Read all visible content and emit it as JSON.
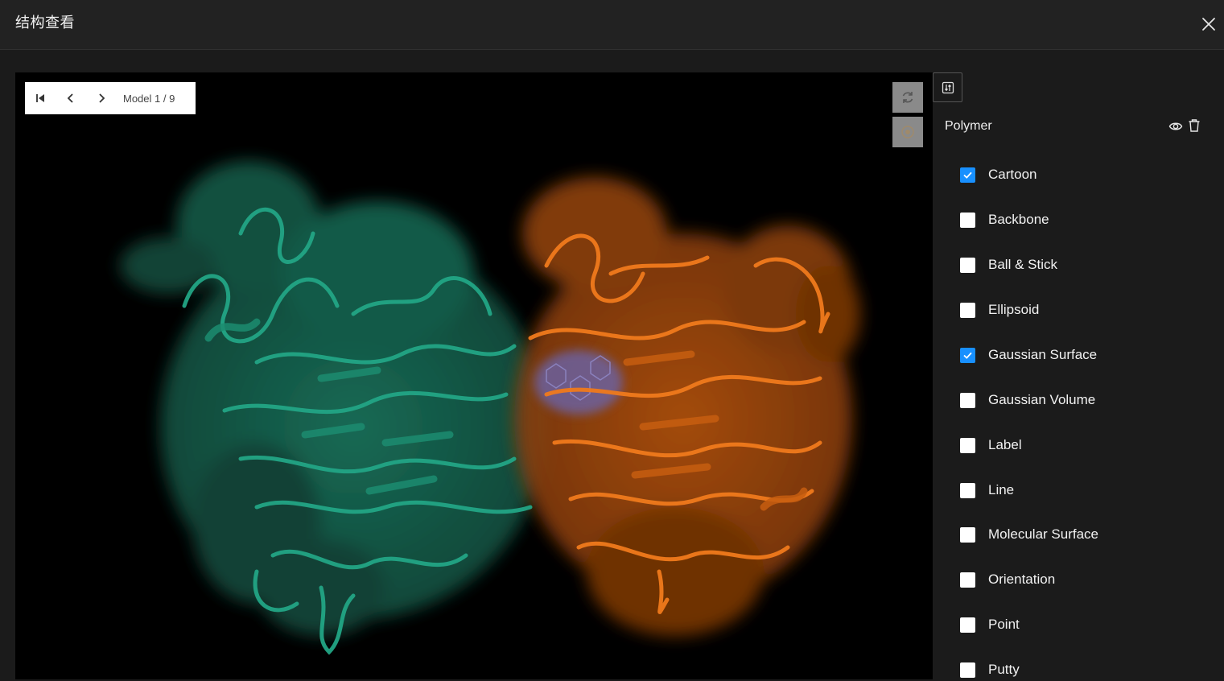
{
  "window": {
    "title": "结构查看"
  },
  "icons": {
    "close": "close-icon",
    "first": "skip-to-first-icon",
    "prev": "chevron-left-icon",
    "next": "chevron-right-icon",
    "reset": "refresh-icon",
    "tool2": "target-icon",
    "settings": "sliders-icon",
    "visibility": "eye-icon",
    "delete": "trash-icon"
  },
  "viewer": {
    "model_label": "Model 1 / 9",
    "colors": {
      "chain_a": "#1a8f74",
      "chain_b": "#d96510",
      "ligand": "#7a6fb0",
      "background": "#000000"
    }
  },
  "panel": {
    "group_title": "Polymer",
    "representations": [
      {
        "label": "Cartoon",
        "checked": true
      },
      {
        "label": "Backbone",
        "checked": false
      },
      {
        "label": "Ball & Stick",
        "checked": false
      },
      {
        "label": "Ellipsoid",
        "checked": false
      },
      {
        "label": "Gaussian Surface",
        "checked": true
      },
      {
        "label": "Gaussian Volume",
        "checked": false
      },
      {
        "label": "Label",
        "checked": false
      },
      {
        "label": "Line",
        "checked": false
      },
      {
        "label": "Molecular Surface",
        "checked": false
      },
      {
        "label": "Orientation",
        "checked": false
      },
      {
        "label": "Point",
        "checked": false
      },
      {
        "label": "Putty",
        "checked": false
      }
    ]
  }
}
